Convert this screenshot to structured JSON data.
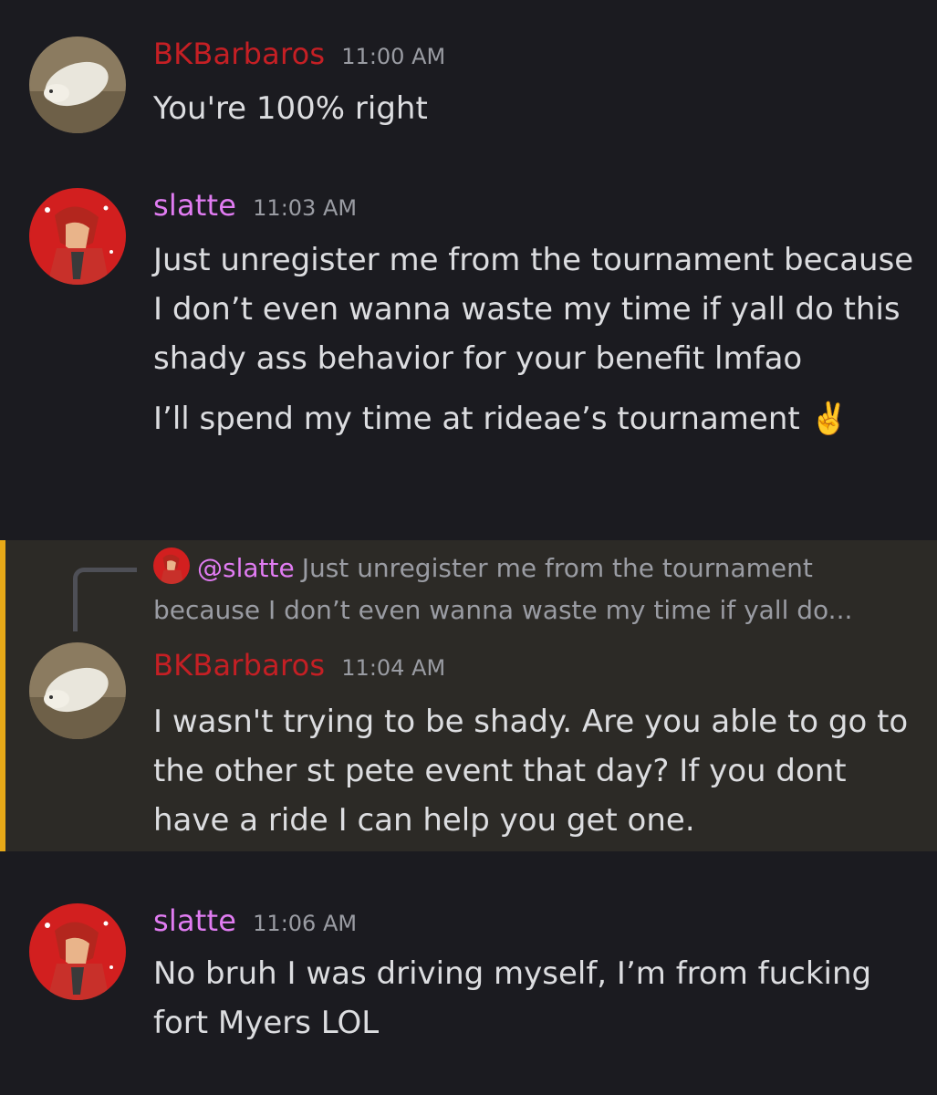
{
  "messages": [
    {
      "author": "BKBarbaros",
      "time": "11:00 AM",
      "lines": [
        "You're 100% right"
      ]
    },
    {
      "author": "slatte",
      "time": "11:03 AM",
      "lines": [
        "Just unregister me from the tournament because I don’t even wanna waste my time if yall do this shady ass behavior for your benefit lmfao",
        "I’ll spend my time at rideae’s tournament"
      ],
      "emoji": "✌️"
    },
    {
      "author": "BKBarbaros",
      "time": "11:04 AM",
      "lines": [
        "I wasn't trying to be shady. Are you able to go to the other st pete event that day? If you dont have a ride I can help you get one."
      ],
      "reply": {
        "author": "@slatte",
        "text": "Just unregister me from the tournament because I don’t even wanna waste my time if yall do..."
      }
    },
    {
      "author": "slatte",
      "time": "11:06 AM",
      "lines": [
        "No bruh I was driving myself, I’m from fucking fort Myers LOL"
      ]
    }
  ],
  "colors": {
    "background": "#1b1b20",
    "bk_name": "#c51f24",
    "slatte_name": "#e17cf2",
    "highlight": "#2c2a26",
    "highlight_bar": "#e7a918"
  }
}
